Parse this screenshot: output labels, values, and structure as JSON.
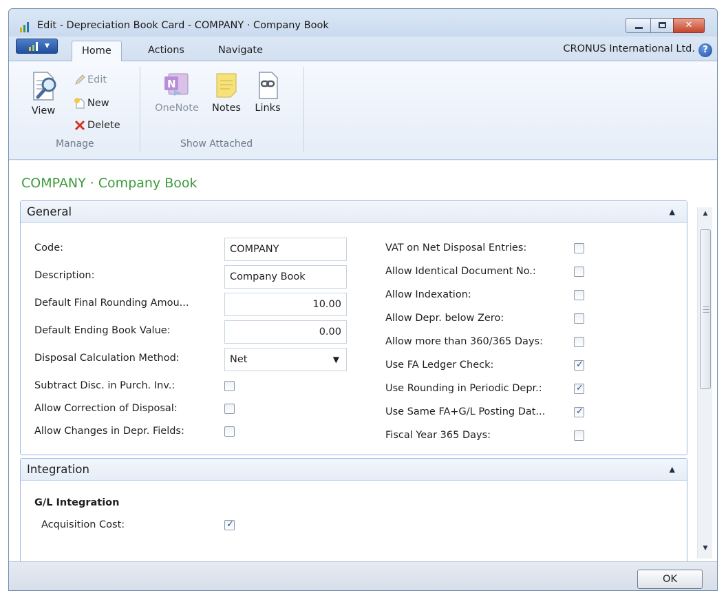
{
  "window": {
    "title": "Edit - Depreciation Book Card - COMPANY · Company Book",
    "controls": {
      "minimize": "minimize",
      "maximize": "maximize",
      "close": "close"
    }
  },
  "ribbon_tabs": [
    {
      "label": "Home",
      "active": true
    },
    {
      "label": "Actions",
      "active": false
    },
    {
      "label": "Navigate",
      "active": false
    }
  ],
  "company": "CRONUS International Ltd.",
  "ribbon": {
    "manage": {
      "view": "View",
      "edit": "Edit",
      "new": "New",
      "delete": "Delete",
      "group": "Manage"
    },
    "show_attached": {
      "onenote": "OneNote",
      "notes": "Notes",
      "links": "Links",
      "group": "Show Attached"
    }
  },
  "page_caption": "COMPANY · Company Book",
  "general": {
    "title": "General",
    "left_fields": [
      {
        "label": "Code:",
        "value": "COMPANY",
        "type": "text"
      },
      {
        "label": "Description:",
        "value": "Company Book",
        "type": "text"
      },
      {
        "label": "Default Final Rounding Amou...",
        "value": "10.00",
        "type": "number"
      },
      {
        "label": "Default Ending Book Value:",
        "value": "0.00",
        "type": "number"
      },
      {
        "label": "Disposal Calculation Method:",
        "value": "Net",
        "type": "select"
      }
    ],
    "left_checks": [
      {
        "label": "Subtract Disc. in Purch. Inv.:",
        "checked": false
      },
      {
        "label": "Allow Correction of Disposal:",
        "checked": false
      },
      {
        "label": "Allow Changes in Depr. Fields:",
        "checked": false
      }
    ],
    "right_checks": [
      {
        "label": "VAT on Net Disposal Entries:",
        "checked": false
      },
      {
        "label": "Allow Identical Document No.:",
        "checked": false
      },
      {
        "label": "Allow Indexation:",
        "checked": false
      },
      {
        "label": "Allow Depr. below Zero:",
        "checked": false
      },
      {
        "label": "Allow more than 360/365 Days:",
        "checked": false
      },
      {
        "label": "Use FA Ledger Check:",
        "checked": true
      },
      {
        "label": "Use Rounding in Periodic Depr.:",
        "checked": true
      },
      {
        "label": "Use Same FA+G/L Posting Dat...",
        "checked": true
      },
      {
        "label": "Fiscal Year 365 Days:",
        "checked": false
      }
    ]
  },
  "integration": {
    "title": "Integration",
    "subheading": "G/L Integration",
    "fields": [
      {
        "label": "Acquisition Cost:",
        "checked": true
      }
    ]
  },
  "buttons": {
    "ok": "OK"
  },
  "icons": {
    "collapse": "chevron-up-icon",
    "dropdown": "chevron-down-icon",
    "check": "check-icon"
  },
  "colors": {
    "caption_green": "#3a9a3a",
    "fasttab_border": "#9ab8e3",
    "close_red": "#c5452c"
  }
}
